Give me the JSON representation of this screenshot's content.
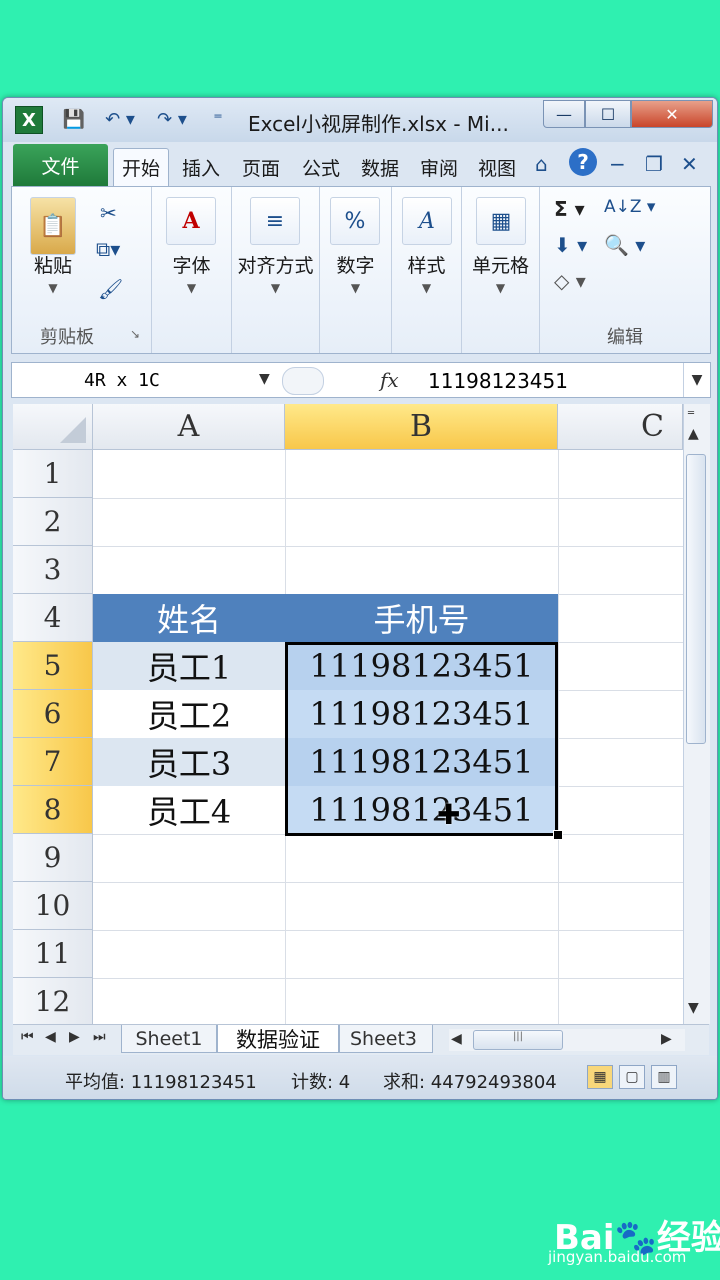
{
  "window": {
    "title": "Excel小视屏制作.xlsx  -  Mi...",
    "min_icon": "—",
    "max_icon": "☐",
    "close_icon": "✕"
  },
  "quick_access": {
    "logo": "X",
    "save": "💾",
    "undo": "↶ ▾",
    "redo": "↷ ▾",
    "customize": "⁼"
  },
  "tabs": {
    "file": "文件",
    "items": [
      "开始",
      "插入",
      "页面",
      "公式",
      "数据",
      "审阅",
      "视图"
    ],
    "right_icons": [
      "⌂",
      "?",
      "−",
      "❐",
      "✕"
    ]
  },
  "ribbon": {
    "clipboard": {
      "paste": "粘贴",
      "group": "剪贴板",
      "launcher": "↘"
    },
    "font": {
      "label": "字体",
      "icon": "A"
    },
    "align": {
      "label": "对齐方式",
      "icon": "≡"
    },
    "number": {
      "label": "数字",
      "icon": "%"
    },
    "style": {
      "label": "样式",
      "icon": "A"
    },
    "cells": {
      "label": "单元格",
      "icon": "▦"
    },
    "edit": {
      "group": "编辑",
      "sum": "Σ ▾",
      "sort": "A↓Z ▾",
      "fill": "⬇ ▾",
      "find": "🔍 ▾",
      "clear": "◇ ▾"
    }
  },
  "formula_bar": {
    "name_box": "4R x 1C",
    "fx": "fx",
    "value": "11198123451"
  },
  "grid": {
    "columns": [
      "A",
      "B",
      "C"
    ],
    "rows": [
      "1",
      "2",
      "3",
      "4",
      "5",
      "6",
      "7",
      "8",
      "9",
      "10",
      "11",
      "12"
    ],
    "table": {
      "headers": [
        "姓名",
        "手机号"
      ],
      "rows": [
        [
          "员工1",
          "11198123451"
        ],
        [
          "员工2",
          "11198123451"
        ],
        [
          "员工3",
          "11198123451"
        ],
        [
          "员工4",
          "11198123451"
        ]
      ]
    }
  },
  "sheets": [
    "Sheet1",
    "数据验证",
    "Sheet3"
  ],
  "status": {
    "average": "平均值: 11198123451",
    "count": "计数: 4",
    "sum": "求和: 44792493804"
  },
  "watermark": {
    "logo": "Bai🐾经验",
    "url": "jingyan.baidu.com"
  }
}
